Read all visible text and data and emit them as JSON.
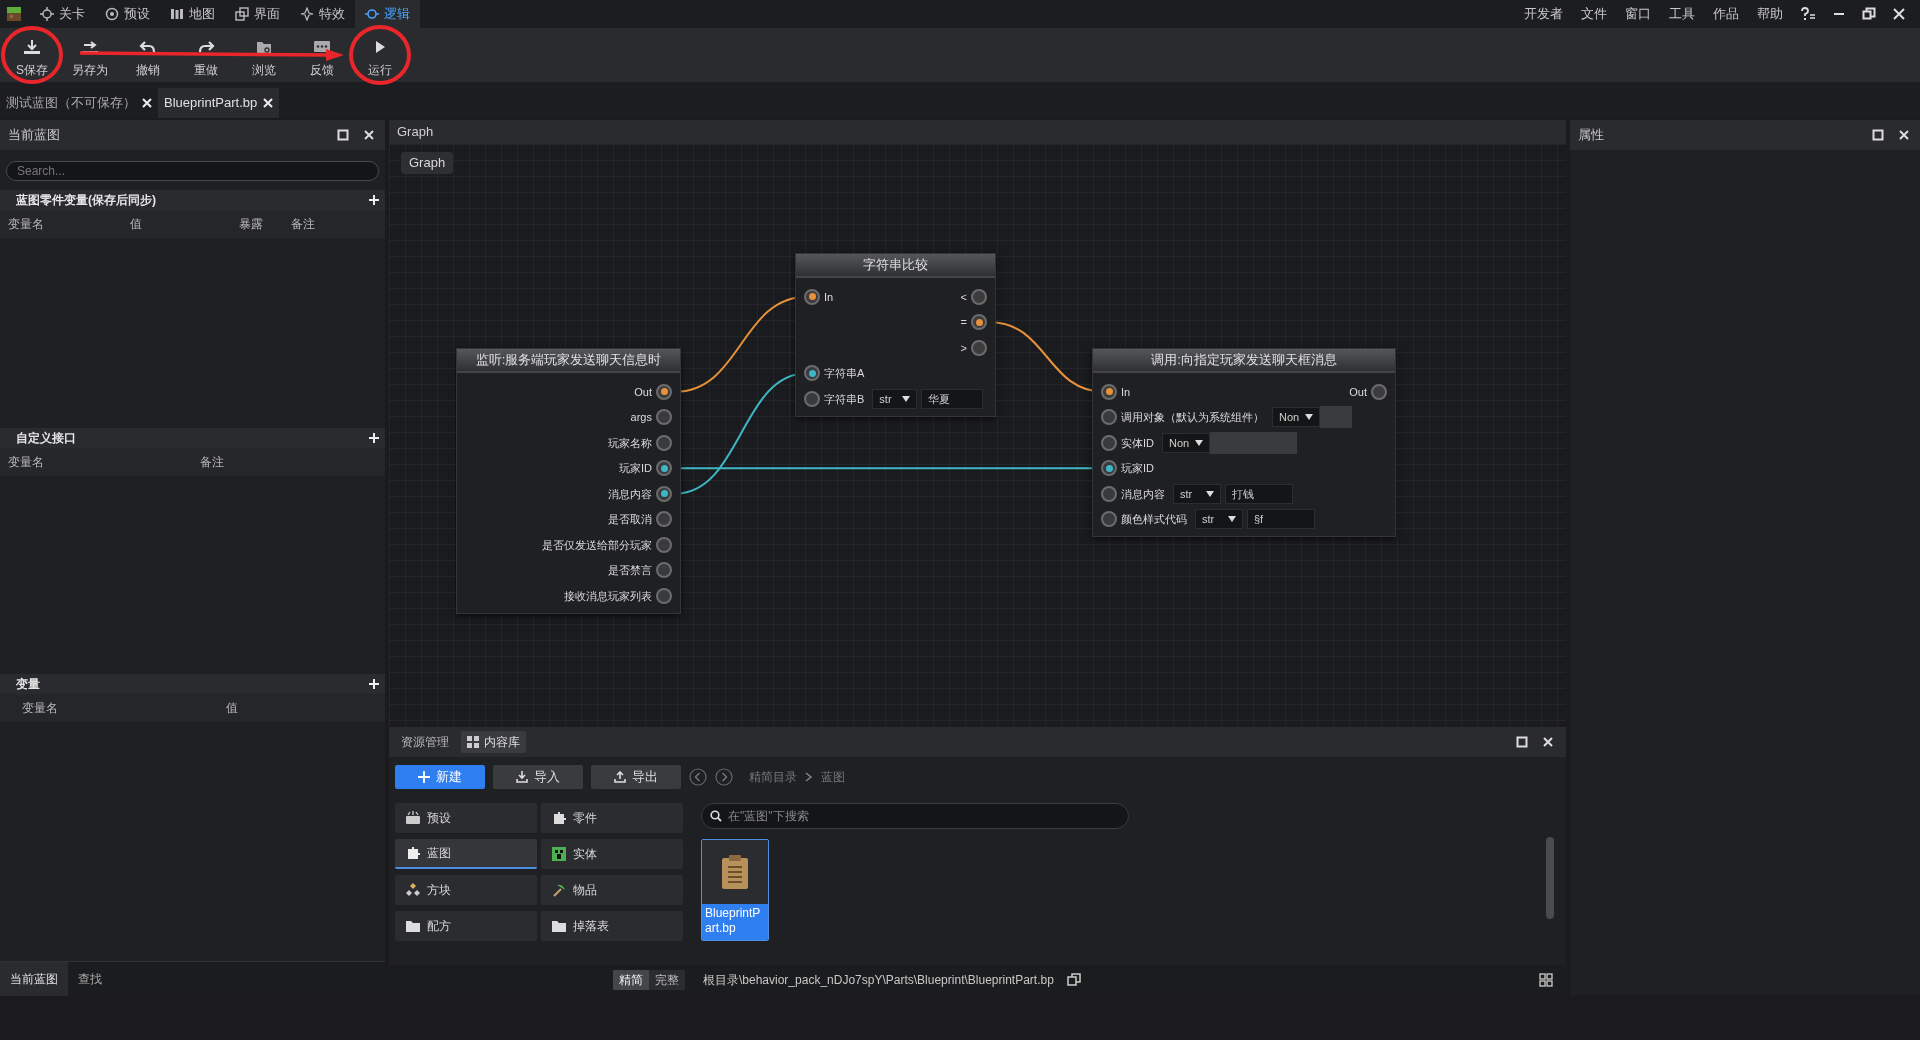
{
  "app_tabs": [
    {
      "label": "关卡",
      "kind": "level",
      "selected": false
    },
    {
      "label": "预设",
      "kind": "preset",
      "selected": false
    },
    {
      "label": "地图",
      "kind": "map",
      "selected": false
    },
    {
      "label": "界面",
      "kind": "ui",
      "selected": false
    },
    {
      "label": "特效",
      "kind": "effect",
      "selected": false
    },
    {
      "label": "逻辑",
      "kind": "logic",
      "selected": true
    }
  ],
  "menu": [
    "开发者",
    "文件",
    "窗口",
    "工具",
    "作品",
    "帮助"
  ],
  "toolbar": [
    {
      "label": "S保存",
      "kind": "save"
    },
    {
      "label": "另存为",
      "kind": "save_as"
    },
    {
      "label": "撤销",
      "kind": "undo"
    },
    {
      "label": "重做",
      "kind": "redo"
    },
    {
      "label": "浏览",
      "kind": "browse"
    },
    {
      "label": "反馈",
      "kind": "feedback"
    },
    {
      "label": "运行",
      "kind": "run"
    }
  ],
  "doc_tabs": [
    {
      "label": "测试蓝图（不可保存）",
      "selected": false
    },
    {
      "label": "BlueprintPart.bp",
      "selected": true
    }
  ],
  "left_panel": {
    "title": "当前蓝图",
    "search": {
      "placeholder": "Search..."
    },
    "sections": [
      {
        "title": "蓝图零件变量(保存后同步)",
        "columns": [
          "变量名",
          "值",
          "暴露",
          "备注"
        ]
      },
      {
        "title": "自定义接口",
        "columns": [
          "变量名",
          "备注"
        ]
      },
      {
        "title": "变量",
        "columns": [
          "变量名",
          "值"
        ]
      }
    ],
    "bottom_tabs": [
      {
        "label": "当前蓝图",
        "selected": true
      },
      {
        "label": "查找",
        "selected": false
      }
    ]
  },
  "graph": {
    "title": "Graph",
    "breadcrumb": "Graph",
    "nodes": [
      {
        "title": "监听:服务端玩家发送聊天信息时",
        "rows": [
          {
            "out": {
              "label": "Out",
              "kind": "exec",
              "connected": true
            }
          },
          {
            "out": {
              "label": "args",
              "kind": "data",
              "connected": false
            }
          },
          {
            "out": {
              "label": "玩家名称",
              "kind": "data",
              "connected": false
            }
          },
          {
            "out": {
              "label": "玩家ID",
              "kind": "data",
              "connected": true
            }
          },
          {
            "out": {
              "label": "消息内容",
              "kind": "data",
              "connected": true
            }
          },
          {
            "out": {
              "label": "是否取消",
              "kind": "data",
              "connected": false
            }
          },
          {
            "out": {
              "label": "是否仅发送给部分玩家",
              "kind": "data",
              "connected": false
            }
          },
          {
            "out": {
              "label": "是否禁言",
              "kind": "data",
              "connected": false
            }
          },
          {
            "out": {
              "label": "接收消息玩家列表",
              "kind": "data",
              "connected": false
            }
          }
        ]
      },
      {
        "title": "字符串比较",
        "rows": [
          {
            "in": {
              "label": "In",
              "kind": "exec",
              "connected": true
            },
            "out": {
              "label": "<",
              "kind": "exec",
              "connected": false
            }
          },
          {
            "out": {
              "label": "=",
              "kind": "exec",
              "connected": true
            }
          },
          {
            "out": {
              "label": ">",
              "kind": "exec",
              "connected": false
            }
          },
          {
            "in": {
              "label": "字符串A",
              "kind": "data",
              "connected": true
            }
          },
          {
            "in": {
              "label": "字符串B",
              "kind": "data",
              "connected": false
            },
            "fields": [
              {
                "kind": "dropdown",
                "value": "str"
              },
              {
                "kind": "text",
                "value": "华夏"
              }
            ]
          }
        ]
      },
      {
        "title": "调用:向指定玩家发送聊天框消息",
        "rows": [
          {
            "in": {
              "label": "In",
              "kind": "exec",
              "connected": true
            },
            "out": {
              "label": "Out",
              "kind": "exec",
              "connected": false
            }
          },
          {
            "in": {
              "label": "调用对象（默认为系统组件）",
              "kind": "data",
              "connected": false
            },
            "fields": [
              {
                "kind": "dropdown",
                "value": "Non"
              },
              {
                "kind": "blank"
              }
            ]
          },
          {
            "in": {
              "label": "实体ID",
              "kind": "data",
              "connected": false
            },
            "fields": [
              {
                "kind": "dropdown",
                "value": "Non"
              },
              {
                "kind": "blank"
              }
            ]
          },
          {
            "in": {
              "label": "玩家ID",
              "kind": "data",
              "connected": true
            }
          },
          {
            "in": {
              "label": "消息内容",
              "kind": "data",
              "connected": false
            },
            "fields": [
              {
                "kind": "dropdown",
                "value": "str"
              },
              {
                "kind": "text",
                "value": "打钱"
              }
            ]
          },
          {
            "in": {
              "label": "颜色样式代码",
              "kind": "data",
              "connected": false
            },
            "fields": [
              {
                "kind": "dropdown",
                "value": "str"
              },
              {
                "kind": "text",
                "value": "§f"
              }
            ]
          }
        ]
      }
    ]
  },
  "properties": {
    "title": "属性"
  },
  "assets": {
    "tabs": [
      {
        "label": "资源管理",
        "selected": false
      },
      {
        "label": "内容库",
        "selected": true
      }
    ],
    "actions": [
      {
        "label": "新建",
        "kind": "new"
      },
      {
        "label": "导入",
        "kind": "import"
      },
      {
        "label": "导出",
        "kind": "export"
      }
    ],
    "breadcrumb": [
      "精简目录",
      "蓝图"
    ],
    "categories": [
      {
        "label": "预设",
        "kind": "preset",
        "selected": false
      },
      {
        "label": "零件",
        "kind": "part",
        "selected": false
      },
      {
        "label": "蓝图",
        "kind": "blueprint",
        "selected": true
      },
      {
        "label": "实体",
        "kind": "entity",
        "selected": false
      },
      {
        "label": "方块",
        "kind": "block",
        "selected": false
      },
      {
        "label": "物品",
        "kind": "item",
        "selected": false
      },
      {
        "label": "配方",
        "kind": "folder",
        "selected": false
      },
      {
        "label": "掉落表",
        "kind": "folder",
        "selected": false
      }
    ],
    "search": {
      "placeholder": "在\"蓝图\"下搜索"
    },
    "files": [
      {
        "name": "BlueprintPart.bp",
        "selected": true
      }
    ],
    "view_modes": [
      {
        "label": "精简",
        "selected": true
      },
      {
        "label": "完整",
        "selected": false
      }
    ],
    "path": "根目录\\behavior_pack_nDJo7spY\\Parts\\Blueprint\\BlueprintPart.bp"
  }
}
